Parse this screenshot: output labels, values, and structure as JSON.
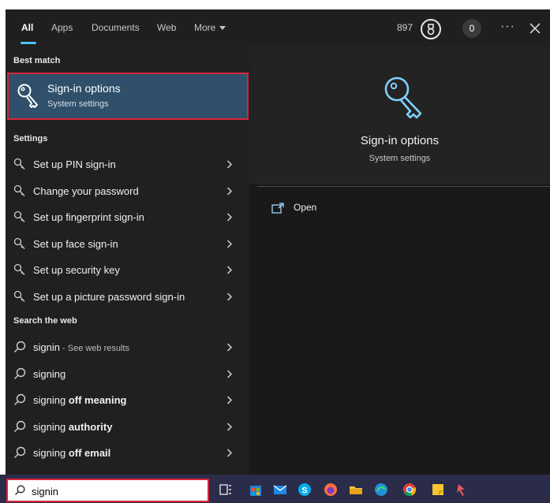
{
  "tabs": [
    {
      "label": "All"
    },
    {
      "label": "Apps"
    },
    {
      "label": "Documents"
    },
    {
      "label": "Web"
    },
    {
      "label": "More"
    }
  ],
  "topbar": {
    "points": "897",
    "badge_count": "0",
    "ellipsis": "···"
  },
  "sections": {
    "best_match": "Best match",
    "settings": "Settings",
    "search_web": "Search the web"
  },
  "best_match": {
    "title": "Sign-in options",
    "subtitle": "System settings",
    "icon": "key-icon"
  },
  "settings_items": [
    {
      "label": "Set up PIN sign-in"
    },
    {
      "label": "Change your password"
    },
    {
      "label": "Set up fingerprint sign-in"
    },
    {
      "label": "Set up face sign-in"
    },
    {
      "label": "Set up security key"
    },
    {
      "label": "Set up a picture password sign-in"
    }
  ],
  "web_items": [
    {
      "prefix": "signin",
      "suffix": "",
      "hint": " - See web results"
    },
    {
      "prefix": "signing",
      "suffix": "",
      "hint": ""
    },
    {
      "prefix": "signing",
      "suffix": " off meaning",
      "hint": ""
    },
    {
      "prefix": "signing",
      "suffix": " authority",
      "hint": ""
    },
    {
      "prefix": "signing",
      "suffix": " off email",
      "hint": ""
    }
  ],
  "preview": {
    "title": "Sign-in options",
    "subtitle": "System settings",
    "open_label": "Open"
  },
  "taskbar": {
    "search_value": "signin",
    "icons": [
      "task-view-icon",
      "store-icon",
      "mail-icon",
      "skype-icon",
      "firefox-icon",
      "file-explorer-icon",
      "edge-icon",
      "chrome-icon",
      "sticky-notes-icon",
      "app-icon"
    ]
  },
  "colors": {
    "accent": "#4cc2ff",
    "highlight": "#2f4f6b",
    "annotation_red": "#d9263a",
    "panel": "#202020",
    "taskbar": "#2b2b4a"
  }
}
